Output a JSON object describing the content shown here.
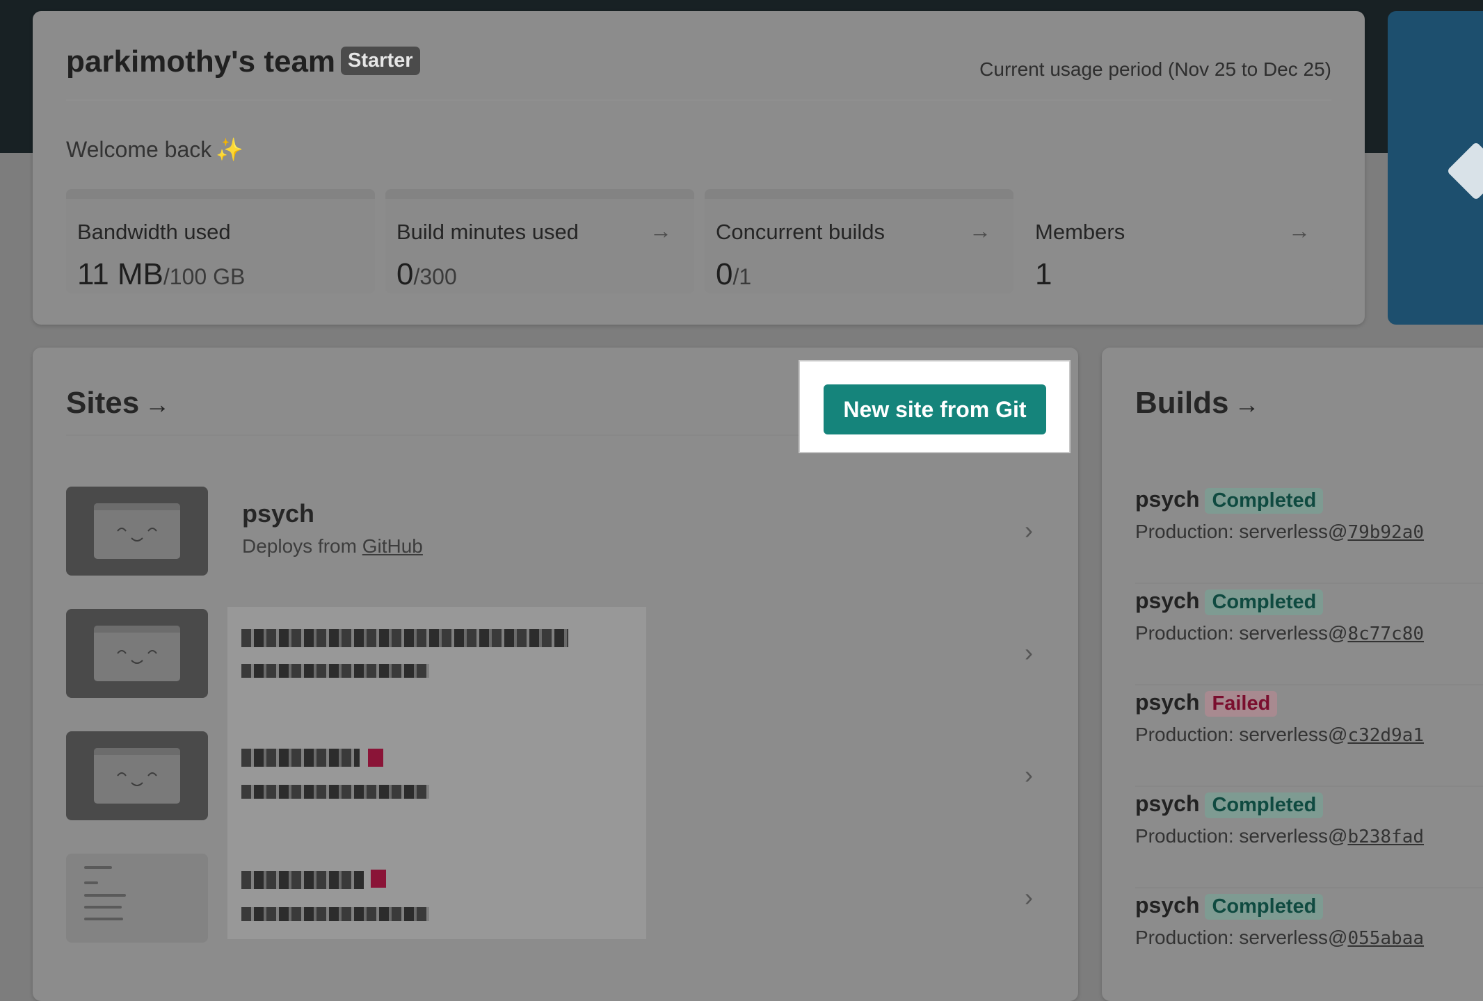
{
  "team": {
    "name": "parkimothy's team",
    "plan": "Starter",
    "usage_period": "Current usage period (Nov 25 to Dec 25)",
    "welcome": "Welcome back",
    "welcome_emoji": "✨"
  },
  "stats": [
    {
      "label": "Bandwidth used",
      "value": "11 MB",
      "unit": "/100 GB",
      "has_arrow": false
    },
    {
      "label": "Build minutes used",
      "value": "0",
      "unit": "/300",
      "has_arrow": true
    },
    {
      "label": "Concurrent builds",
      "value": "0",
      "unit": "/1",
      "has_arrow": true
    },
    {
      "label": "Members",
      "value": "1",
      "unit": "",
      "has_arrow": true
    }
  ],
  "arrow_glyph": "→",
  "chevron_glyph": "›",
  "sites": {
    "title": "Sites",
    "new_site_button": "New site from Git",
    "items": [
      {
        "name": "psych",
        "deploy_prefix": "Deploys from ",
        "deploy_source": "GitHub",
        "redacted": false
      },
      {
        "name": "",
        "redacted": true
      },
      {
        "name": "",
        "redacted": true
      },
      {
        "name": "",
        "redacted": true
      }
    ]
  },
  "builds": {
    "title": "Builds",
    "items": [
      {
        "site": "psych",
        "status": "Completed",
        "context": "Production: serverless@",
        "commit": "79b92a0"
      },
      {
        "site": "psych",
        "status": "Completed",
        "context": "Production: serverless@",
        "commit": "8c77c80"
      },
      {
        "site": "psych",
        "status": "Failed",
        "context": "Production: serverless@",
        "commit": "c32d9a1"
      },
      {
        "site": "psych",
        "status": "Completed",
        "context": "Production: serverless@",
        "commit": "b238fad"
      },
      {
        "site": "psych",
        "status": "Completed",
        "context": "Production: serverless@",
        "commit": "055abaa"
      }
    ]
  },
  "colors": {
    "primary_button": "#15847b",
    "completed_badge_text": "#0f4a40",
    "failed_badge_text": "#7a0e2e",
    "header_bar": "#182124",
    "promo_panel": "#1d4f6e"
  }
}
